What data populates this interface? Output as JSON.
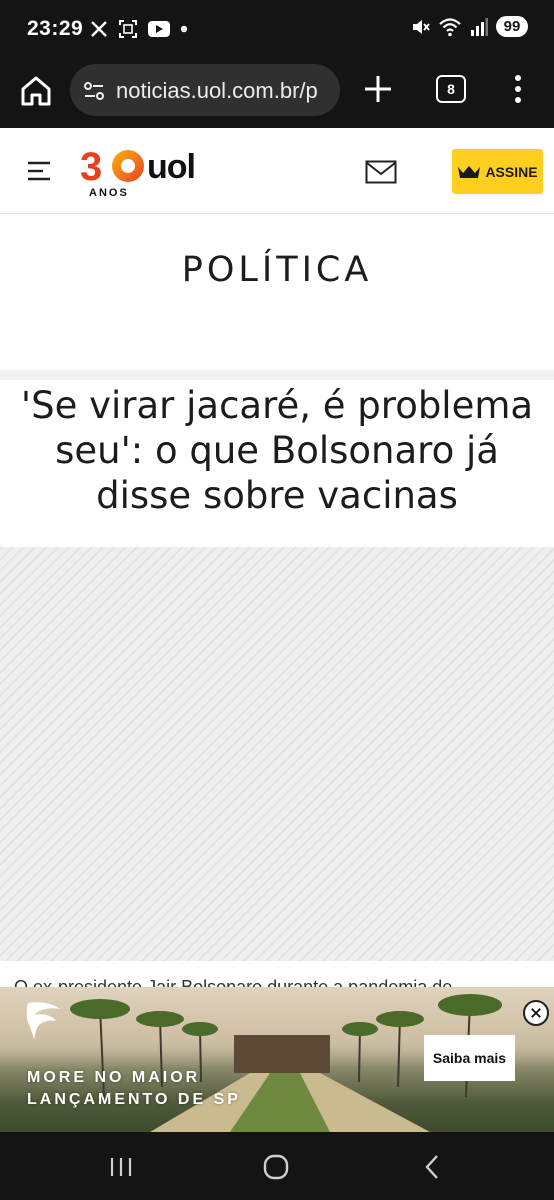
{
  "status_bar": {
    "time": "23:29",
    "battery": "99",
    "left_icons": [
      "x-icon",
      "screenshot-icon",
      "youtube-icon",
      "dot-icon"
    ],
    "right_icons": [
      "mute-icon",
      "wifi-icon",
      "signal-icon",
      "battery-icon"
    ]
  },
  "browser": {
    "url": "noticias.uol.com.br/p",
    "tab_count": "8",
    "icons": [
      "home-icon",
      "site-settings-icon",
      "new-tab-icon",
      "tabs-icon",
      "menu-icon"
    ]
  },
  "site_header": {
    "logo_number": "30",
    "logo_word": "uol",
    "logo_subtext": "ANOS",
    "subscribe_label": "ASSINE",
    "icons": [
      "hamburger-icon",
      "mail-icon",
      "crown-icon"
    ]
  },
  "article": {
    "section": "POLÍTICA",
    "headline": "'Se virar jacaré, é problema seu': o que Bolsonaro já disse sobre vacinas",
    "caption_partial": "O ex-presidente Jair Bolsonaro durante a pandemia de"
  },
  "ad_banner": {
    "text_line1": "MORE NO MAIOR",
    "text_line2": "LANÇAMENTO DE SP",
    "cta_label": "Saiba mais"
  },
  "colors": {
    "system_bar": "#141414",
    "url_box": "#303030",
    "subscribe_yellow": "#ffcf1f",
    "logo_orange": "#e8401c",
    "logo_yellow": "#f7b500"
  },
  "nav_bar": {
    "icons": [
      "recents-icon",
      "home-circle-icon",
      "back-icon"
    ]
  }
}
